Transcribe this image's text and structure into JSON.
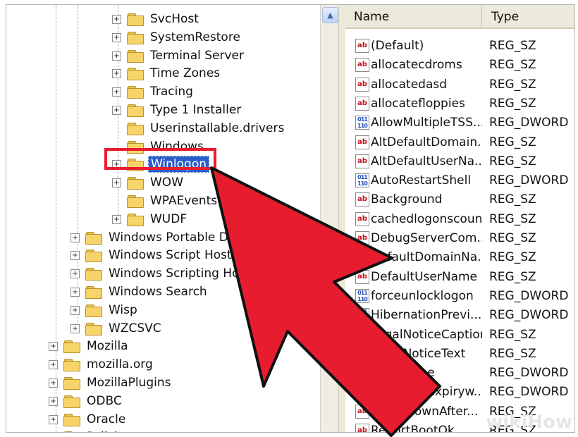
{
  "tree": {
    "items": [
      {
        "label": "SvcHost",
        "level": 2,
        "expander": "+"
      },
      {
        "label": "SystemRestore",
        "level": 2,
        "expander": "+"
      },
      {
        "label": "Terminal Server",
        "level": 2,
        "expander": "+"
      },
      {
        "label": "Time Zones",
        "level": 2,
        "expander": "+"
      },
      {
        "label": "Tracing",
        "level": 2,
        "expander": "+"
      },
      {
        "label": "Type 1 Installer",
        "level": 2,
        "expander": "+"
      },
      {
        "label": "Userinstallable.drivers",
        "level": 2,
        "expander": ""
      },
      {
        "label": "Windows",
        "level": 2,
        "expander": ""
      },
      {
        "label": "Winlogon",
        "level": 2,
        "expander": "+",
        "selected": true
      },
      {
        "label": "WOW",
        "level": 2,
        "expander": "+"
      },
      {
        "label": "WPAEvents",
        "level": 2,
        "expander": ""
      },
      {
        "label": "WUDF",
        "level": 2,
        "expander": "+"
      },
      {
        "label": "Windows Portable De",
        "level": 1,
        "expander": "+"
      },
      {
        "label": "Windows Script Host",
        "level": 1,
        "expander": "+"
      },
      {
        "label": "Windows Scripting Host",
        "level": 1,
        "expander": "+"
      },
      {
        "label": "Windows Search",
        "level": 1,
        "expander": "+"
      },
      {
        "label": "Wisp",
        "level": 1,
        "expander": "+"
      },
      {
        "label": "WZCSVC",
        "level": 1,
        "expander": "+"
      },
      {
        "label": "Mozilla",
        "level": 0,
        "expander": "+"
      },
      {
        "label": "mozilla.org",
        "level": 0,
        "expander": "+"
      },
      {
        "label": "MozillaPlugins",
        "level": 0,
        "expander": "+"
      },
      {
        "label": "ODBC",
        "level": 0,
        "expander": "+"
      },
      {
        "label": "Oracle",
        "level": 0,
        "expander": "+"
      },
      {
        "label": "Policies",
        "level": 0,
        "expander": "+"
      }
    ]
  },
  "scrollbar": {
    "up_glyph": "▲"
  },
  "list": {
    "columns": {
      "name": "Name",
      "type": "Type"
    },
    "rows": [
      {
        "name": "(Default)",
        "type": "REG_SZ",
        "icon": "ab"
      },
      {
        "name": "allocatecdroms",
        "type": "REG_SZ",
        "icon": "ab"
      },
      {
        "name": "allocatedasd",
        "type": "REG_SZ",
        "icon": "ab"
      },
      {
        "name": "allocatefloppies",
        "type": "REG_SZ",
        "icon": "ab"
      },
      {
        "name": "AllowMultipleTSS...",
        "type": "REG_DWORD",
        "icon": "bin"
      },
      {
        "name": "AltDefaultDomain...",
        "type": "REG_SZ",
        "icon": "ab"
      },
      {
        "name": "AltDefaultUserNa...",
        "type": "REG_SZ",
        "icon": "ab"
      },
      {
        "name": "AutoRestartShell",
        "type": "REG_DWORD",
        "icon": "bin"
      },
      {
        "name": "Background",
        "type": "REG_SZ",
        "icon": "ab"
      },
      {
        "name": "cachedlogonscount",
        "type": "REG_SZ",
        "icon": "ab"
      },
      {
        "name": "DebugServerCom...",
        "type": "REG_SZ",
        "icon": "ab"
      },
      {
        "name": "DefaultDomainNa...",
        "type": "REG_SZ",
        "icon": "ab"
      },
      {
        "name": "DefaultUserName",
        "type": "REG_SZ",
        "icon": "ab"
      },
      {
        "name": "forceunlocklogon",
        "type": "REG_DWORD",
        "icon": "bin"
      },
      {
        "name": "HibernationPrevi...",
        "type": "REG_DWORD",
        "icon": "bin"
      },
      {
        "name": "LegalNoticeCaption",
        "type": "REG_SZ",
        "icon": "ab"
      },
      {
        "name": "LegalNoticeText",
        "type": "REG_SZ",
        "icon": "ab"
      },
      {
        "name": "LogonType",
        "type": "REG_DWORD",
        "icon": "bin"
      },
      {
        "name": "passwordexpiryw...",
        "type": "REG_DWORD",
        "icon": "bin"
      },
      {
        "name": "PowerdownAfter...",
        "type": "REG_SZ",
        "icon": "ab"
      },
      {
        "name": "ReportBootOk",
        "type": "REG_SZ",
        "icon": "ab"
      }
    ]
  },
  "icon_text": {
    "sz": "ab",
    "dw": "011 110"
  },
  "overlay": {
    "arrow_color": "#e81c2f",
    "highlight_color": "#e81c2f"
  },
  "watermark": "wikiHow"
}
